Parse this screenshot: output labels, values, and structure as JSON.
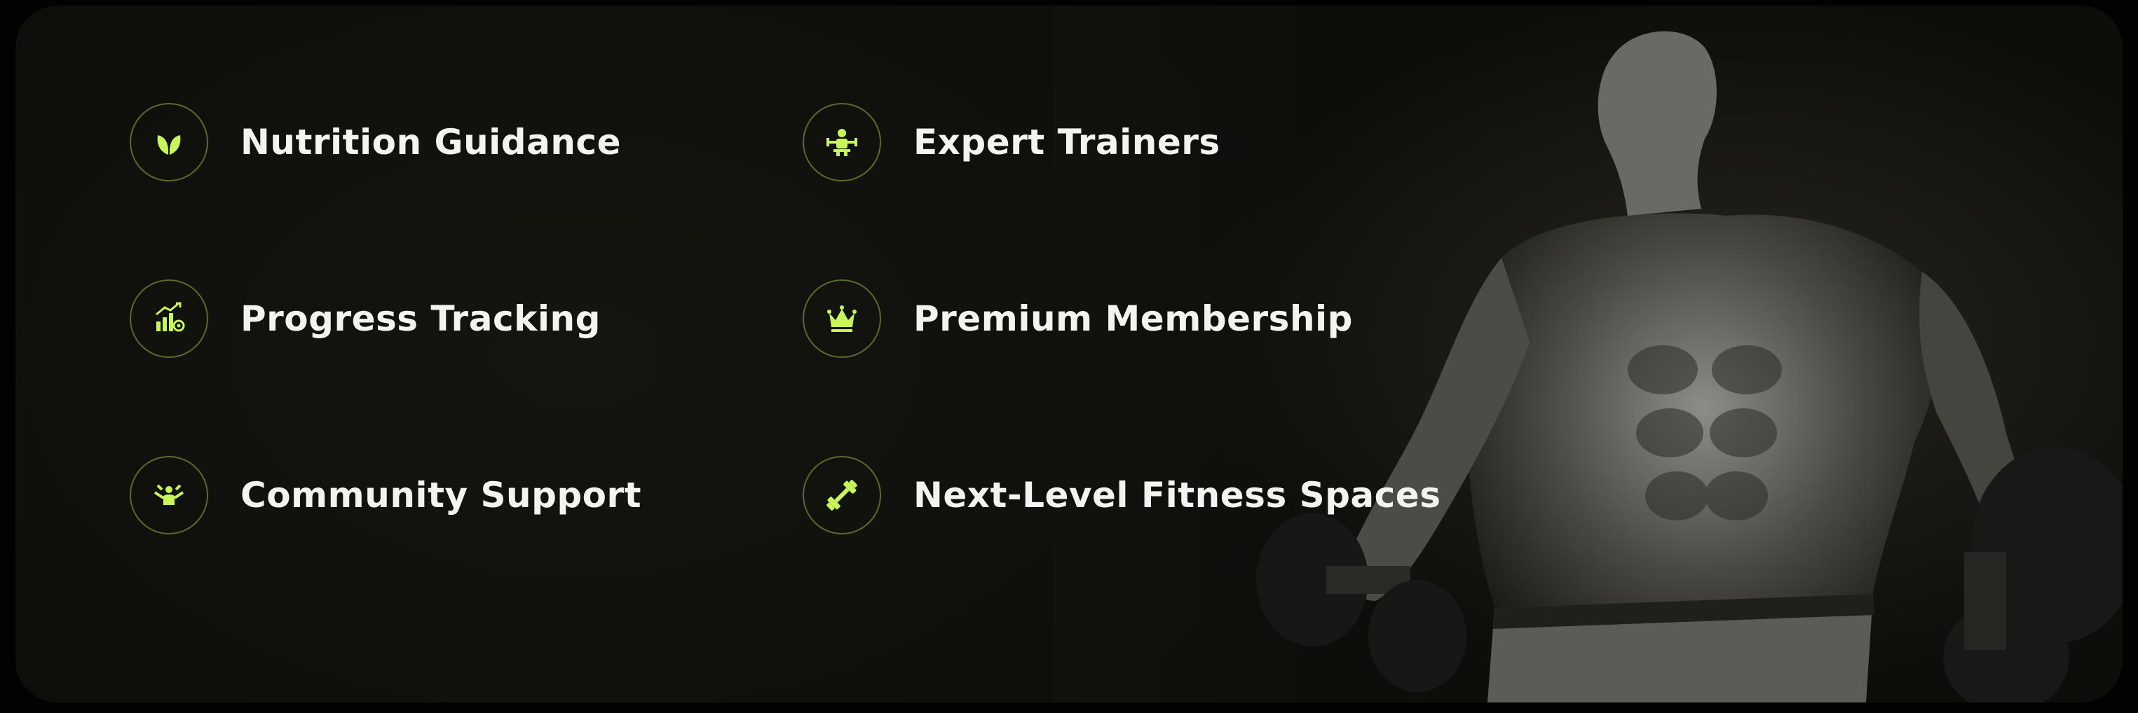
{
  "features": {
    "nutrition": {
      "label": "Nutrition Guidance",
      "icon": "leaf-icon"
    },
    "trainers": {
      "label": "Expert Trainers",
      "icon": "trainer-icon"
    },
    "progress": {
      "label": "Progress Tracking",
      "icon": "progress-chart-icon"
    },
    "membership": {
      "label": "Premium Membership",
      "icon": "crown-icon"
    },
    "community": {
      "label": "Community Support",
      "icon": "community-icon"
    },
    "spaces": {
      "label": "Next-Level Fitness Spaces",
      "icon": "dumbbell-icon"
    }
  },
  "colors": {
    "accent": "#c8f55a",
    "ring": "#5a6a2a",
    "background": "#11110d",
    "text": "#f3f3f0"
  },
  "hero_image": {
    "subject": "muscular-athlete-with-dumbbells"
  }
}
